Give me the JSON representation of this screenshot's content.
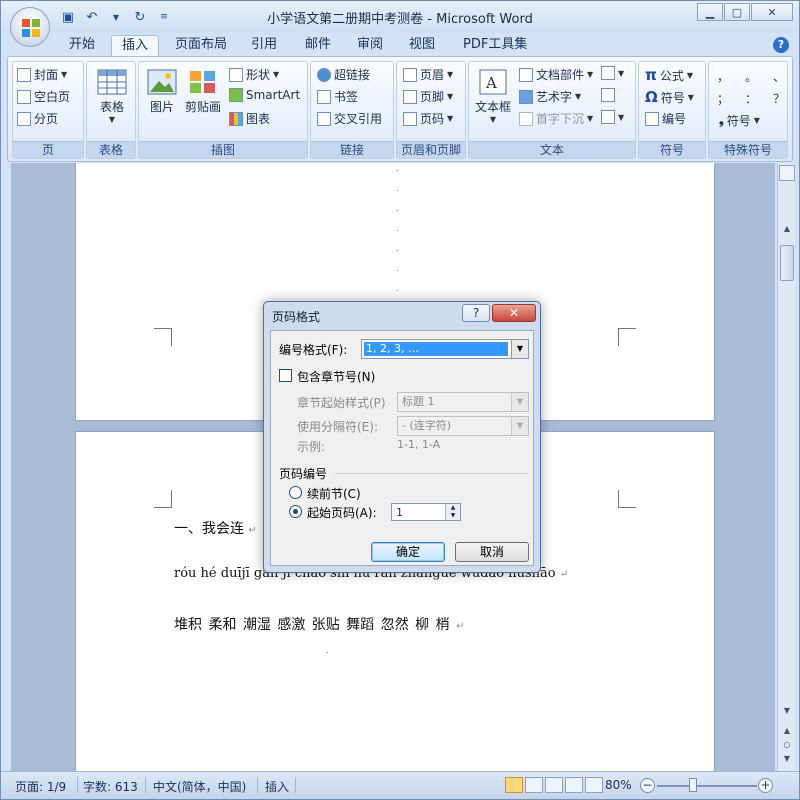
{
  "window": {
    "title": "小学语文第二册期中考测卷 - Microsoft Word"
  },
  "tabs": [
    "开始",
    "插入",
    "页面布局",
    "引用",
    "邮件",
    "审阅",
    "视图",
    "PDF工具集"
  ],
  "active_tab": "插入",
  "ribbon": {
    "page": {
      "label": "页",
      "cover": "封面",
      "blank": "空白页",
      "break": "分页"
    },
    "table": {
      "label": "表格",
      "button": "表格"
    },
    "illustrations": {
      "label": "插图",
      "picture": "图片",
      "clipart": "剪贴画",
      "shapes": "形状",
      "smartart": "SmartArt",
      "chart": "图表"
    },
    "links": {
      "label": "链接",
      "hyperlink": "超链接",
      "bookmark": "书签",
      "crossref": "交叉引用"
    },
    "header_footer": {
      "label": "页眉和页脚",
      "header": "页眉",
      "footer": "页脚",
      "page_number": "页码"
    },
    "text": {
      "label": "文本",
      "textbox": "文本框",
      "quickparts": "文档部件",
      "wordart": "艺术字",
      "dropcap": "首字下沉"
    },
    "symbols": {
      "label": "符号",
      "equation": "公式",
      "symbol": "符号",
      "number": "编号"
    },
    "special": {
      "label": "特殊符号",
      "row1": [
        "，",
        "。",
        "、"
      ],
      "row2": [
        "；",
        "：",
        "？"
      ],
      "symbol": "符号"
    }
  },
  "document": {
    "section_heading": "一、我会连",
    "pinyin_line": "róu hé duījī gǎn jī cháo shī hū rán zhānguè wǔdǎo liǔshāo",
    "words_line": "堆积 柔和 潮湿 感激 张贴 舞蹈 忽然 柳 梢"
  },
  "dialog": {
    "title": "页码格式",
    "help": "?",
    "close": "✕",
    "format_label": "编号格式(F):",
    "format_value": "1, 2, 3, …",
    "include_chapter_label": "包含章节号(N)",
    "chapter_style_label": "章节起始样式(P)",
    "chapter_style_value": "标题 1",
    "separator_label": "使用分隔符(E):",
    "separator_value": "-  (连字符)",
    "example_label": "示例:",
    "example_value": "1-1, 1-A",
    "numbering_section_label": "页码编号",
    "continue_label": "续前节(C)",
    "start_at_label": "起始页码(A):",
    "start_at_value": "1",
    "ok": "确定",
    "cancel": "取消"
  },
  "status": {
    "page": "页面: 1/9",
    "words": "字数: 613",
    "language": "中文(简体，中国)",
    "mode": "插入",
    "zoom": "80%"
  }
}
